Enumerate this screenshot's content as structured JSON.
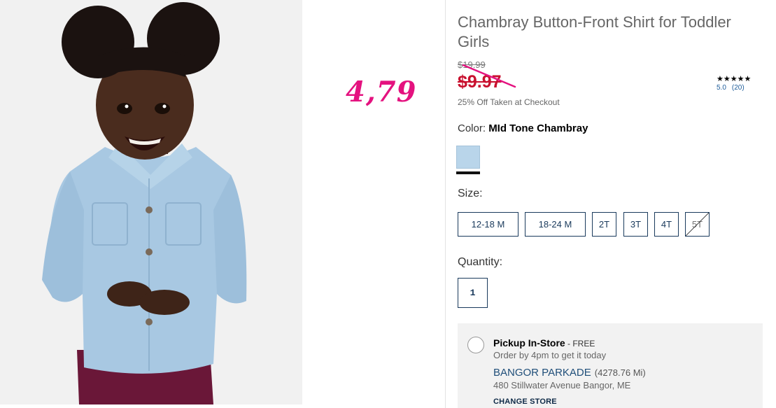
{
  "handwritten_note": "4,79",
  "product": {
    "title": "Chambray Button-Front Shirt for Toddler Girls",
    "price_original": "$19.99",
    "price_sale": "$9.97",
    "promo": "25% Off Taken at Checkout",
    "rating": {
      "stars": "★★★★★",
      "score": "5.0",
      "count": "(20)"
    }
  },
  "color": {
    "label": "Color:",
    "selected": "MId Tone Chambray",
    "swatch_hex": "#b9d5ea"
  },
  "size": {
    "label": "Size:",
    "options": [
      {
        "label": "12-18 M",
        "available": true
      },
      {
        "label": "18-24 M",
        "available": true
      },
      {
        "label": "2T",
        "available": true
      },
      {
        "label": "3T",
        "available": true
      },
      {
        "label": "4T",
        "available": true
      },
      {
        "label": "5T",
        "available": false
      }
    ]
  },
  "quantity": {
    "label": "Quantity:",
    "value": "1"
  },
  "pickup": {
    "title": "Pickup In-Store",
    "free": " - FREE",
    "subtitle": "Order by 4pm to get it today",
    "store_name": "BANGOR PARKADE",
    "distance": "(4278.76 Mi)",
    "address": "480 Stillwater Avenue Bangor, ME",
    "change_label": "CHANGE STORE"
  },
  "colors": {
    "sale_red": "#c8102e",
    "note_pink": "#e4127f",
    "navy": "#1a3a5c",
    "link_blue": "#1f5d9a"
  }
}
